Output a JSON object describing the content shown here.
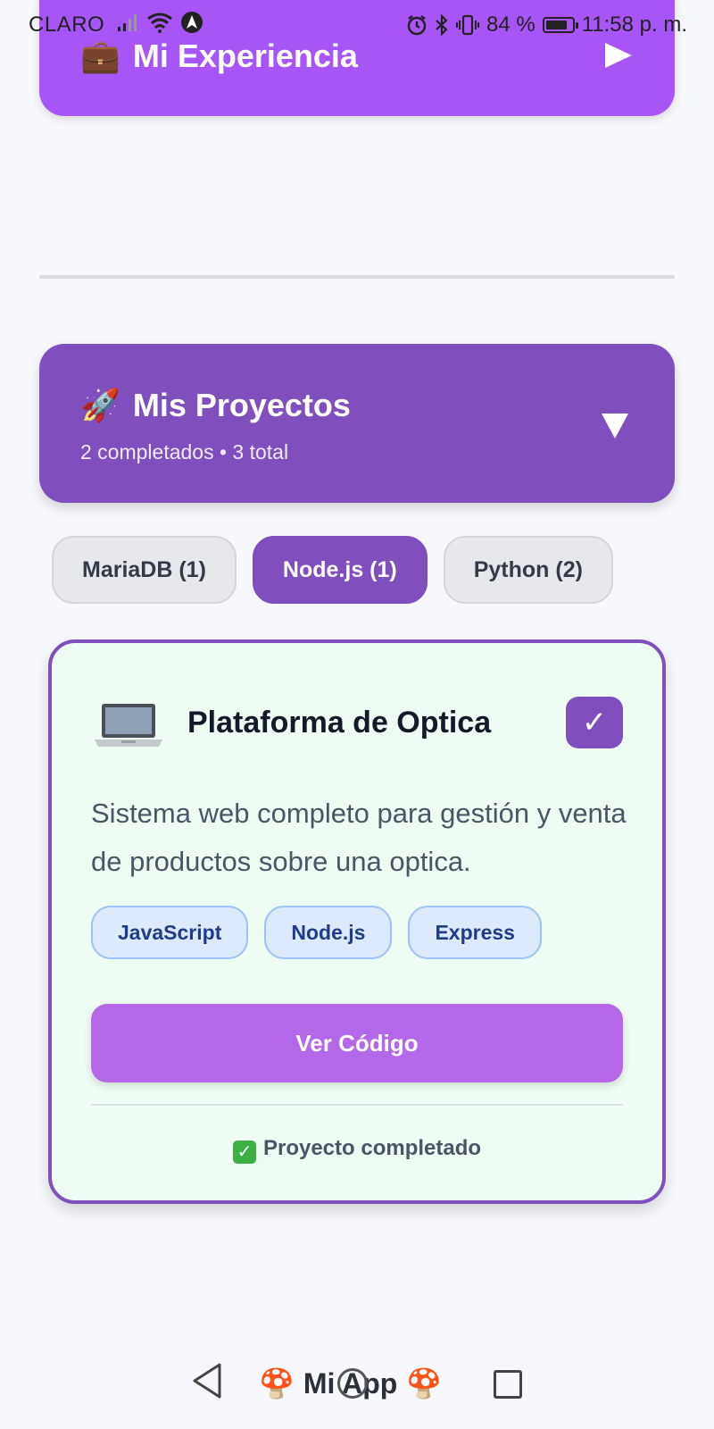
{
  "status_bar": {
    "carrier": "CLARO",
    "battery_percent": "84 %",
    "battery_level": 0.84,
    "time": "11:58 p. m.",
    "icons": [
      "signal-icon",
      "wifi-icon",
      "navigation-icon",
      "alarm-icon",
      "bluetooth-icon",
      "vibrate-icon",
      "battery-icon"
    ]
  },
  "experience": {
    "icon": "💼",
    "title": "Mi Experiencia",
    "toggle_icon": "play-right-icon"
  },
  "projects": {
    "icon": "🚀",
    "title": "Mis Proyectos",
    "subtitle": "2 completados • 3 total",
    "toggle_icon": "caret-down-icon"
  },
  "filters": [
    {
      "label": "MariaDB (1)",
      "active": false
    },
    {
      "label": "Node.js (1)",
      "active": true
    },
    {
      "label": "Python (2)",
      "active": false
    }
  ],
  "project_card": {
    "icon": "laptop-icon",
    "title": "Plataforma de Optica",
    "check": "✓",
    "description": "Sistema web completo para gestión y venta de productos sobre una optica.",
    "tags": [
      "JavaScript",
      "Node.js",
      "Express"
    ],
    "button_label": "Ver Código",
    "status_text": "Proyecto completado",
    "status_icon": "✓"
  },
  "navbar": {
    "title": "Mi App",
    "left_icon": "🍄",
    "right_icon": "🍄"
  },
  "colors": {
    "experience": "#a855f7",
    "projects": "#7e4fbd",
    "button": "#b467e8",
    "card_bg": "#effcf4"
  }
}
